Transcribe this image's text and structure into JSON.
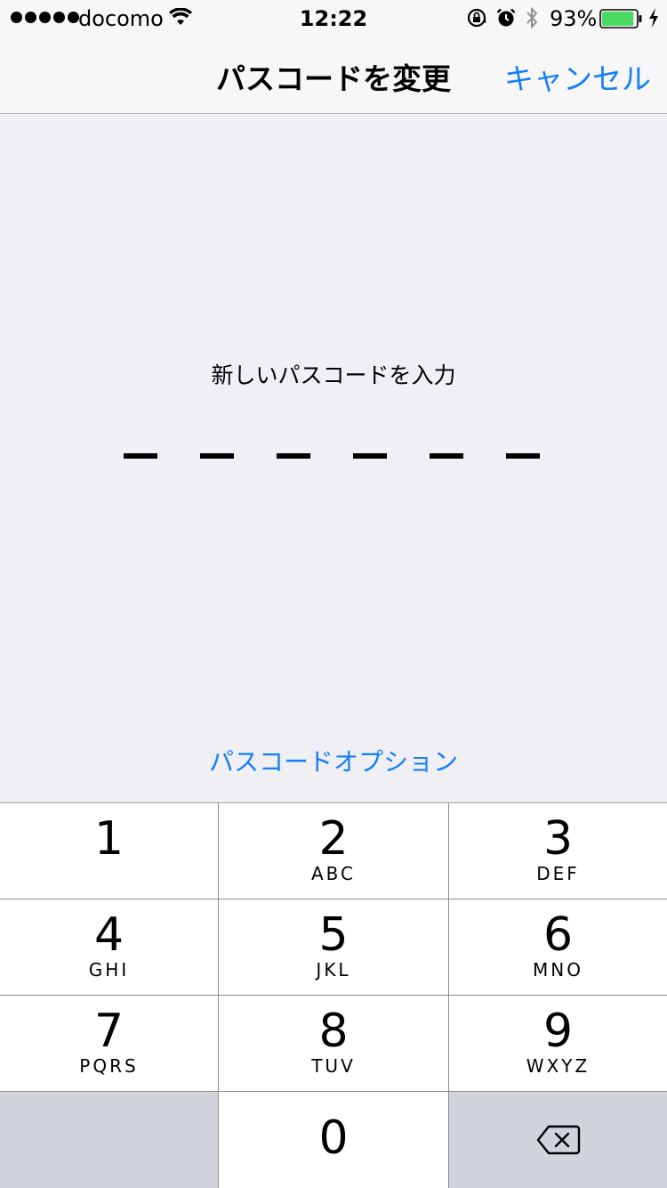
{
  "status_bar": {
    "carrier": "docomo",
    "time": "12:22",
    "battery_percent": "93%",
    "battery_level": 0.93,
    "icons": [
      "signal-dots-icon",
      "wifi-icon",
      "rotation-lock-icon",
      "alarm-icon",
      "bluetooth-icon",
      "battery-icon",
      "charging-icon"
    ]
  },
  "nav": {
    "title": "パスコードを変更",
    "cancel_label": "キャンセル"
  },
  "main": {
    "prompt": "新しいパスコードを入力",
    "digit_slots": 6,
    "options_link": "パスコードオプション"
  },
  "keypad": {
    "keys": [
      {
        "num": "1",
        "letters": ""
      },
      {
        "num": "2",
        "letters": "ABC"
      },
      {
        "num": "3",
        "letters": "DEF"
      },
      {
        "num": "4",
        "letters": "GHI"
      },
      {
        "num": "5",
        "letters": "JKL"
      },
      {
        "num": "6",
        "letters": "MNO"
      },
      {
        "num": "7",
        "letters": "PQRS"
      },
      {
        "num": "8",
        "letters": "TUV"
      },
      {
        "num": "9",
        "letters": "WXYZ"
      },
      {
        "num": "0",
        "letters": ""
      }
    ],
    "backspace_icon": "backspace-icon"
  },
  "colors": {
    "accent": "#157efb",
    "background": "#efeff4",
    "bar": "#f7f7f7",
    "key_gray": "#d1d5db",
    "battery": "#4cd964"
  }
}
